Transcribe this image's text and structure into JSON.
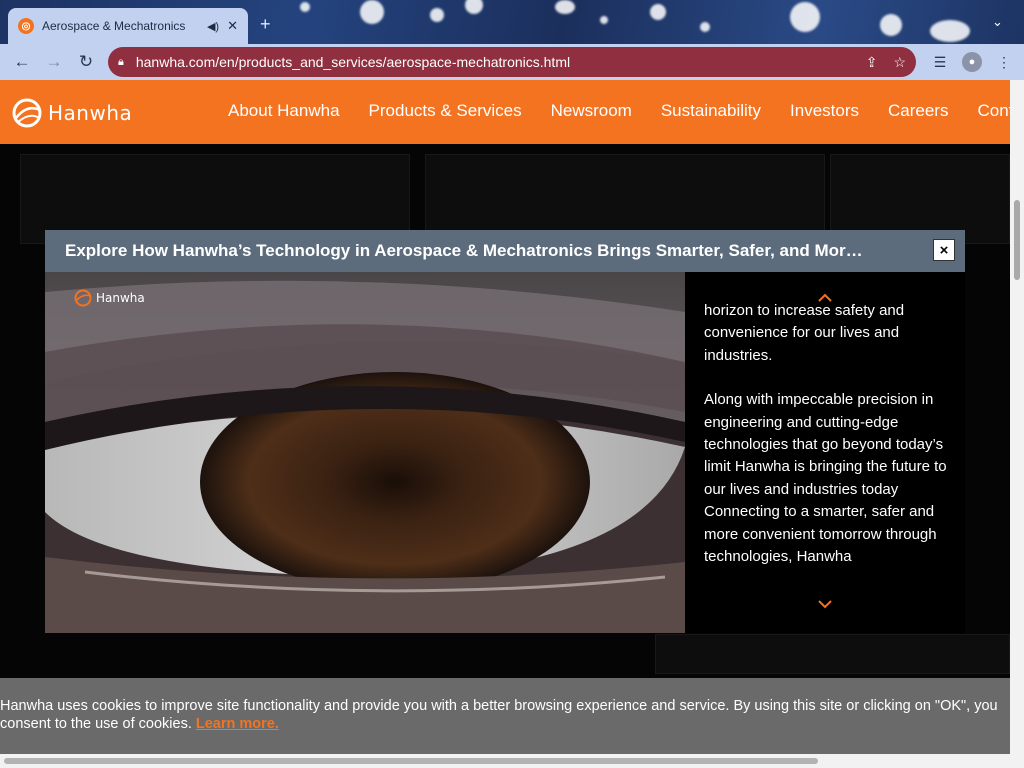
{
  "browser": {
    "tab_title": "Aerospace & Mechatronics",
    "url": "hanwha.com/en/products_and_services/aerospace-mechatronics.html",
    "newtab_icon": "plus-icon"
  },
  "site": {
    "brand": "Hanwha",
    "brand_color": "#f37321",
    "nav": [
      "About Hanwha",
      "Products & Services",
      "Newsroom",
      "Sustainability",
      "Investors",
      "Careers",
      "Cont"
    ]
  },
  "modal": {
    "title": "Explore How Hanwha’s Technology in Aerospace & Mechatronics Brings Smarter, Safer, and More C...",
    "close_label": "×",
    "video_logo_text": "Hanwha",
    "side_paragraphs": [
      "horizon to increase safety and convenience for our lives and industries.",
      "Along with impeccable precision in engineering and cutting-edge technologies that go beyond today’s limit Hanwha is bringing the future to our lives and industries today Connecting to a smarter, safer and more convenient tomorrow through technologies, Hanwha"
    ]
  },
  "cookie": {
    "text": "Hanwha uses cookies to improve site functionality and provide you with a better browsing experience and service. By using this site or clicking on \"OK\", you consent to the use of cookies. ",
    "learn_more": "Learn more."
  }
}
